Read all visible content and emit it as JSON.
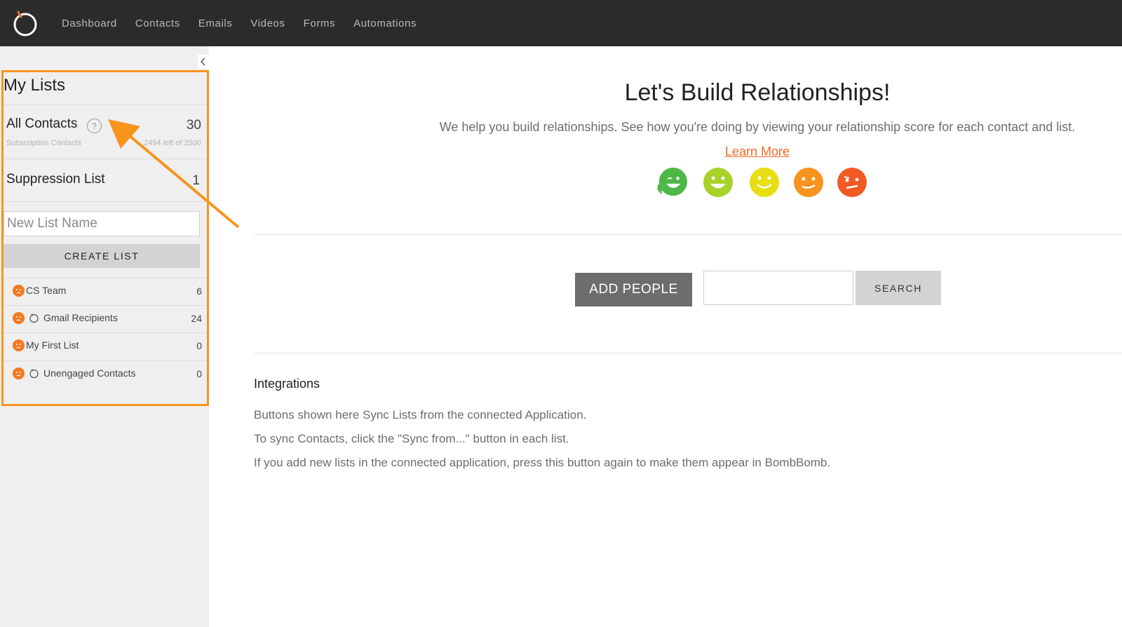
{
  "nav": {
    "items": [
      "Dashboard",
      "Contacts",
      "Emails",
      "Videos",
      "Forms",
      "Automations"
    ]
  },
  "sidebar": {
    "title": "My Lists",
    "collapse_icon": "chevron-left-icon",
    "all_contacts": {
      "label": "All Contacts",
      "help_glyph": "?",
      "count": "30",
      "subscription_label": "Subscription Contacts",
      "remaining": "2494 left of 2500"
    },
    "suppression": {
      "label": "Suppression List",
      "count": "1"
    },
    "new_list_placeholder": "New List Name",
    "create_list_label": "CREATE LIST",
    "lists": [
      {
        "name": "CS Team",
        "count": "6",
        "synced": false
      },
      {
        "name": "Gmail Recipients",
        "count": "24",
        "synced": true
      },
      {
        "name": "My First List",
        "count": "0",
        "synced": false
      },
      {
        "name": "Unengaged Contacts",
        "count": "0",
        "synced": true
      }
    ]
  },
  "main": {
    "title": "Let's Build Relationships!",
    "subtitle": "We help you build relationships. See how you're doing by viewing your relationship score for each contact and list.",
    "learn_more": "Learn More",
    "faces": [
      {
        "name": "thumbs-up-wink-face-icon",
        "color": "#4cb848"
      },
      {
        "name": "happy-face-icon",
        "color": "#a8d12a"
      },
      {
        "name": "smile-face-icon",
        "color": "#e7df12"
      },
      {
        "name": "meh-face-icon",
        "color": "#f7931e"
      },
      {
        "name": "unhappy-face-icon",
        "color": "#f15a24"
      }
    ],
    "add_people_label": "ADD PEOPLE",
    "search_value": "",
    "search_label": "SEARCH",
    "integrations": {
      "title": "Integrations",
      "lines": [
        "Buttons shown here Sync Lists from the connected Application.",
        "To sync Contacts, click the \"Sync from...\" button in each list.",
        "If you add new lists in the connected application, press this button again to make them appear in BombBomb."
      ]
    }
  },
  "colors": {
    "accent": "#f7941d",
    "link": "#f06a24",
    "list_face": "#f47a24",
    "topbar": "#2b2b2b"
  }
}
